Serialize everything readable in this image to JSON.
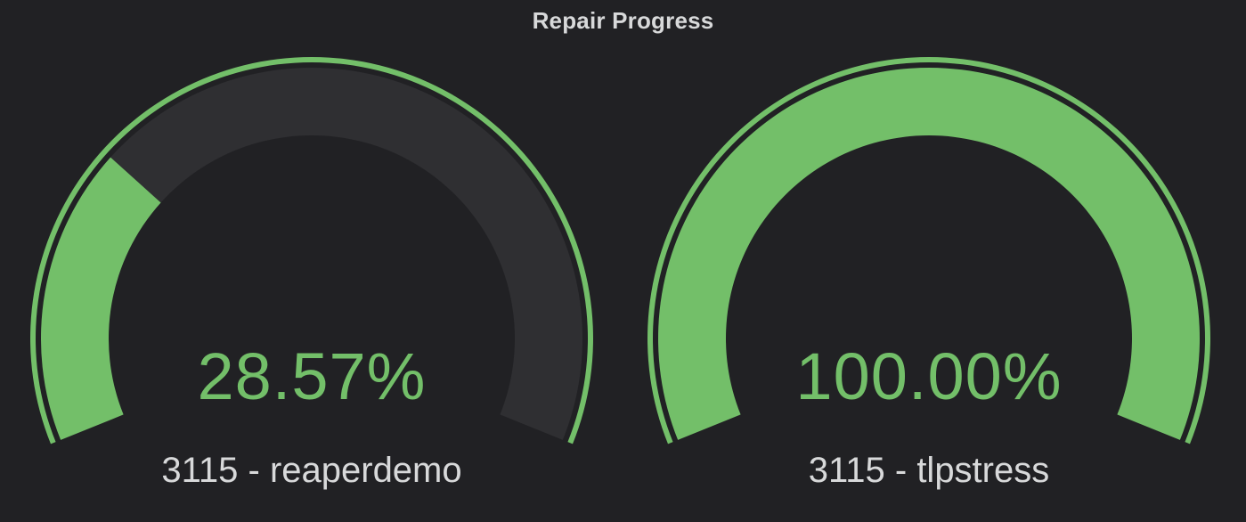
{
  "panel": {
    "title": "Repair Progress"
  },
  "gauges": [
    {
      "value_text": "28.57%",
      "value": 28.57,
      "label": "3115 - reaperdemo"
    },
    {
      "value_text": "100.00%",
      "value": 100.0,
      "label": "3115 - tlpstress"
    }
  ],
  "gauge_min": 0,
  "gauge_max": 100,
  "colors": {
    "background": "#212124",
    "fill": "#73bf69",
    "track": "#2f2f32",
    "threshold": "#73bf69",
    "text": "#d8d9da"
  }
}
